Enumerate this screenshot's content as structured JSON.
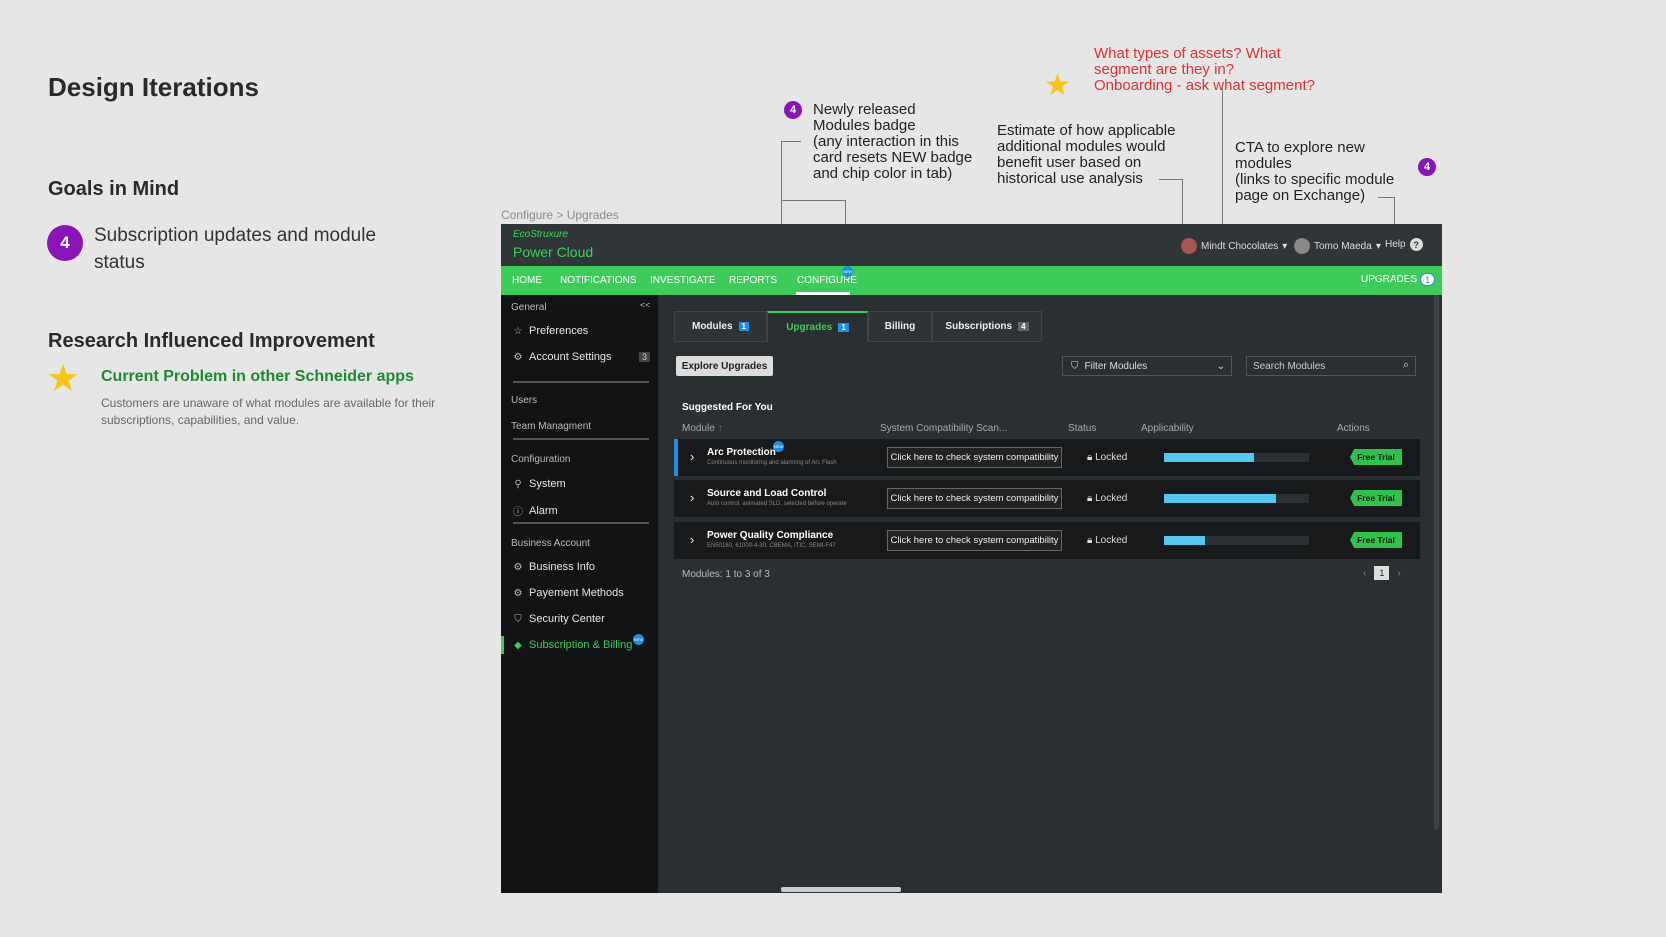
{
  "page": {
    "title": "Design Iterations",
    "goals_heading": "Goals in Mind",
    "goal_number": "4",
    "goal_text": "Subscription updates and module status",
    "research_heading": "Research Influenced Improvement",
    "problem_title": "Current Problem in other Schneider apps",
    "problem_desc": "Customers are unaware of what modules are available for their subscriptions, capabilities, and value."
  },
  "annotations": {
    "red_question": [
      "What types of assets? What",
      "segment are they in?",
      "Onboarding - ask what segment?"
    ],
    "badge_number": "4",
    "new_badge": [
      "Newly released",
      "Modules badge",
      "(any interaction in this",
      "card resets NEW badge",
      "and chip color in tab)"
    ],
    "estimate": [
      "Estimate of how applicable",
      "additional modules would",
      "benefit user based on",
      "historical use analysis"
    ],
    "cta": [
      "CTA to explore new",
      "modules",
      "(links to specific module",
      "page on Exchange)"
    ],
    "cta_badge": "4"
  },
  "app": {
    "breadcrumb": "Configure > Upgrades",
    "logo_small": "EcoStruxure",
    "logo_big": "Power Cloud",
    "org": "Mindt Chocolates",
    "user": "Tomo Maeda",
    "help": "Help",
    "nav": [
      "HOME",
      "NOTIFICATIONS",
      "INVESTIGATE",
      "REPORTS",
      "CONFIGURE"
    ],
    "nav_upgrades": "UPGRADES",
    "nav_upgrades_count": "1",
    "new_badge_text": "NEW",
    "sidebar": {
      "collapse": "<<",
      "general": "General",
      "preferences": "Preferences",
      "account_settings": "Account Settings",
      "account_settings_count": "3",
      "users": "Users",
      "team_management": "Team Managment",
      "configuration": "Configuration",
      "system": "System",
      "alarm": "Alarm",
      "business_account": "Business Account",
      "business_info": "Business Info",
      "payment_methods": "Payement Methods",
      "security_center": "Security Center",
      "subscription_billing": "Subscription & Billing"
    },
    "tabs": [
      {
        "label": "Modules",
        "count": "1"
      },
      {
        "label": "Upgrades",
        "count": "1"
      },
      {
        "label": "Billing",
        "count": ""
      },
      {
        "label": "Subscriptions",
        "count": "4"
      }
    ],
    "explore_button": "Explore Upgrades",
    "filter_placeholder": "Filter Modules",
    "search_placeholder": "Search Modules",
    "suggested": "Suggested For You",
    "columns": [
      "Module",
      "System Compatibility Scan...",
      "Status",
      "Applicability",
      "Actions"
    ],
    "rows": [
      {
        "name": "Arc Protection",
        "desc": "Continuous monitoring and alarming of Arc Flash",
        "check": "Click here to check system compatibility",
        "status": "Locked",
        "applicability": 0.62,
        "action": "Free Trial"
      },
      {
        "name": "Source and Load Control",
        "desc": "Auto control, animated SLD, selected before operate",
        "check": "Click here to check system compatibility",
        "status": "Locked",
        "applicability": 0.77,
        "action": "Free Trial"
      },
      {
        "name": "Power Quality Compliance",
        "desc": "EN50160, 61000-4-30, CBEMA, ITIC, SEMI-F47",
        "check": "Click here to check system compatibility",
        "status": "Locked",
        "applicability": 0.28,
        "action": "Free Trial"
      }
    ],
    "modules_count": "Modules: 1 to 3 of 3",
    "page_current": "1"
  },
  "colors": {
    "accent_green": "#3dcb5a",
    "badge_purple": "#8b14b8",
    "bar_blue": "#56c8f0",
    "red_note": "#e03030"
  },
  "icons": [
    "star-icon",
    "search-icon",
    "filter-icon",
    "chevron-right-icon",
    "lock-icon",
    "help-icon"
  ]
}
